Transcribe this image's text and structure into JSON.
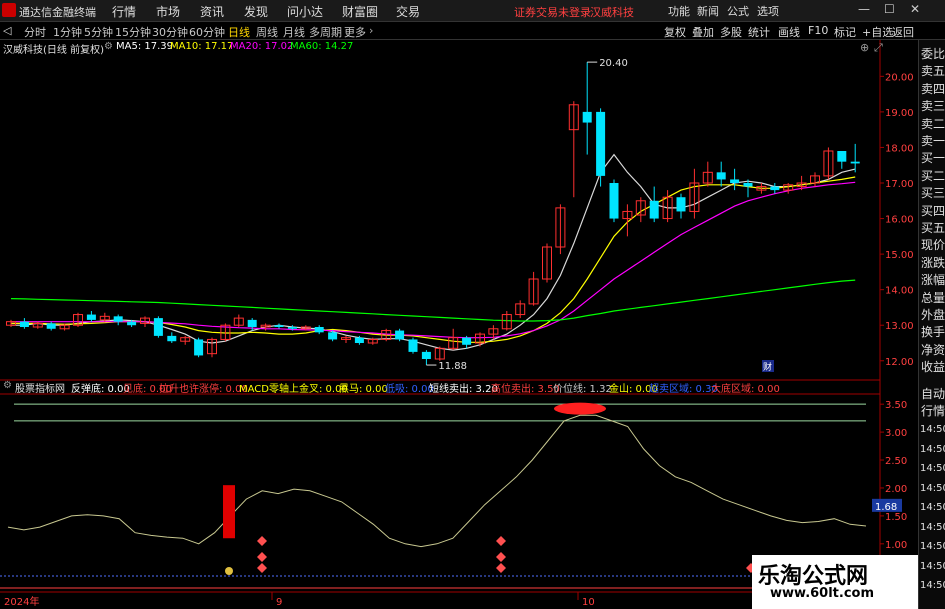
{
  "menubar": {
    "app_name": "通达信金融终端",
    "items": [
      "行情",
      "市场",
      "资讯",
      "发现",
      "问小达",
      "财富圈",
      "交易"
    ],
    "notice": "证券交易未登录",
    "stock_title": "汉威科技",
    "right_items": [
      "功能",
      "新闻",
      "公式",
      "选项"
    ],
    "win_controls": [
      "—",
      "☐",
      "✕"
    ]
  },
  "period_bar": {
    "items": [
      "分时",
      "1分钟",
      "5分钟",
      "15分钟",
      "30分钟",
      "60分钟",
      "日线",
      "周线",
      "月线",
      "多周期",
      "更多"
    ],
    "active": "日线",
    "right_tools": [
      "复权",
      "叠加",
      "多股",
      "统计",
      "画线",
      "F10",
      "标记",
      "+自选",
      "返回"
    ]
  },
  "info_line": {
    "stock": "汉威科技(日线 前复权)",
    "ma5": "MA5: 17.39",
    "ma10": "MA10: 17.17",
    "ma20": "MA20: 17.02",
    "ma60": "MA60: 14.27",
    "colors": {
      "ma5": "#ffffff",
      "ma10": "#ffff00",
      "ma20": "#ff00ff",
      "ma60": "#00ff00"
    }
  },
  "price_axis": [
    "20.00",
    "19.00",
    "18.00",
    "17.00",
    "16.00",
    "15.00",
    "14.00",
    "13.00",
    "12.00"
  ],
  "annotations": {
    "high": "20.40",
    "low": "11.88",
    "finance_marker": "财"
  },
  "indicator_line": {
    "name": "股票指标网",
    "items": [
      {
        "label": "反弹底: 0.00",
        "color": "#ffffff"
      },
      {
        "label": "见底: 0.00",
        "color": "#ff4040"
      },
      {
        "label": "拉升也许涨停: 0.00",
        "color": "#ff4040"
      },
      {
        "label": "MACD零轴上金叉: 0.00",
        "color": "#ffff00"
      },
      {
        "label": "黑马: 0.00",
        "color": "#ffff00"
      },
      {
        "label": "低吸: 0.00",
        "color": "#3060ff"
      },
      {
        "label": "短线卖出: 3.20",
        "color": "#ffffff"
      },
      {
        "label": "高位卖出: 3.50",
        "color": "#ff4040"
      },
      {
        "label": "价位线: 1.32",
        "color": "#c8c8c8"
      },
      {
        "label": "金山: 0.00",
        "color": "#ffff00"
      },
      {
        "label": "超卖区域: 0.30",
        "color": "#3060ff"
      },
      {
        "label": "大底区域: 0.00",
        "color": "#ff4040"
      }
    ]
  },
  "indicator_axis": [
    "3.50",
    "3.00",
    "2.50",
    "2.00",
    "1.50",
    "1.00"
  ],
  "indicator_current": "1.68",
  "time_axis": [
    "2024年",
    "9",
    "10"
  ],
  "side_tabs_top": [
    "委比",
    "卖五",
    "卖四",
    "卖三",
    "卖二",
    "卖一",
    "买一",
    "买二",
    "买三",
    "买四",
    "买五",
    "现价",
    "涨跌",
    "涨幅",
    "总量",
    "外盘",
    "换手",
    "净资",
    "收益"
  ],
  "side_tabs_bottom": [
    "自动",
    "行情"
  ],
  "side_times": [
    "14:50",
    "14:50",
    "14:50",
    "14:50",
    "14:50",
    "14:50",
    "14:50",
    "14:50",
    "14:50"
  ],
  "watermark": {
    "line1": "乐淘公式网",
    "line2": "www.60lt.com"
  },
  "chart_data": {
    "type": "candlestick",
    "price_range": [
      11.6,
      20.6
    ],
    "candles": [
      {
        "o": 13.0,
        "c": 13.1,
        "h": 13.15,
        "l": 12.95
      },
      {
        "o": 13.1,
        "c": 12.95,
        "h": 13.2,
        "l": 12.9
      },
      {
        "o": 12.95,
        "c": 13.05,
        "h": 13.1,
        "l": 12.9
      },
      {
        "o": 13.05,
        "c": 12.9,
        "h": 13.1,
        "l": 12.85
      },
      {
        "o": 12.9,
        "c": 13.0,
        "h": 13.05,
        "l": 12.85
      },
      {
        "o": 13.0,
        "c": 13.3,
        "h": 13.35,
        "l": 12.95
      },
      {
        "o": 13.3,
        "c": 13.15,
        "h": 13.4,
        "l": 13.1
      },
      {
        "o": 13.15,
        "c": 13.25,
        "h": 13.35,
        "l": 13.1
      },
      {
        "o": 13.25,
        "c": 13.1,
        "h": 13.3,
        "l": 13.0
      },
      {
        "o": 13.1,
        "c": 13.0,
        "h": 13.15,
        "l": 12.95
      },
      {
        "o": 13.05,
        "c": 13.2,
        "h": 13.25,
        "l": 12.95
      },
      {
        "o": 13.2,
        "c": 12.7,
        "h": 13.25,
        "l": 12.65
      },
      {
        "o": 12.7,
        "c": 12.55,
        "h": 12.8,
        "l": 12.5
      },
      {
        "o": 12.55,
        "c": 12.65,
        "h": 12.7,
        "l": 12.45
      },
      {
        "o": 12.6,
        "c": 12.15,
        "h": 12.65,
        "l": 12.1
      },
      {
        "o": 12.2,
        "c": 12.6,
        "h": 12.65,
        "l": 12.1
      },
      {
        "o": 12.6,
        "c": 13.0,
        "h": 13.05,
        "l": 12.55
      },
      {
        "o": 13.0,
        "c": 13.2,
        "h": 13.3,
        "l": 12.95
      },
      {
        "o": 13.15,
        "c": 12.95,
        "h": 13.2,
        "l": 12.85
      },
      {
        "o": 12.95,
        "c": 13.0,
        "h": 13.05,
        "l": 12.85
      },
      {
        "o": 13.0,
        "c": 12.95,
        "h": 13.05,
        "l": 12.9
      },
      {
        "o": 12.95,
        "c": 12.9,
        "h": 13.0,
        "l": 12.85
      },
      {
        "o": 12.9,
        "c": 12.95,
        "h": 13.0,
        "l": 12.85
      },
      {
        "o": 12.95,
        "c": 12.8,
        "h": 13.0,
        "l": 12.75
      },
      {
        "o": 12.8,
        "c": 12.6,
        "h": 12.85,
        "l": 12.55
      },
      {
        "o": 12.6,
        "c": 12.65,
        "h": 12.7,
        "l": 12.5
      },
      {
        "o": 12.65,
        "c": 12.5,
        "h": 12.7,
        "l": 12.45
      },
      {
        "o": 12.5,
        "c": 12.6,
        "h": 12.65,
        "l": 12.45
      },
      {
        "o": 12.6,
        "c": 12.85,
        "h": 12.9,
        "l": 12.55
      },
      {
        "o": 12.85,
        "c": 12.6,
        "h": 12.9,
        "l": 12.55
      },
      {
        "o": 12.6,
        "c": 12.25,
        "h": 12.65,
        "l": 12.2
      },
      {
        "o": 12.25,
        "c": 12.05,
        "h": 12.3,
        "l": 11.88
      },
      {
        "o": 12.05,
        "c": 12.35,
        "h": 12.4,
        "l": 12.0
      },
      {
        "o": 12.35,
        "c": 12.65,
        "h": 12.9,
        "l": 12.3
      },
      {
        "o": 12.65,
        "c": 12.45,
        "h": 12.7,
        "l": 12.35
      },
      {
        "o": 12.5,
        "c": 12.75,
        "h": 12.8,
        "l": 12.4
      },
      {
        "o": 12.75,
        "c": 12.9,
        "h": 13.0,
        "l": 12.6
      },
      {
        "o": 12.9,
        "c": 13.3,
        "h": 13.4,
        "l": 12.85
      },
      {
        "o": 13.3,
        "c": 13.6,
        "h": 13.7,
        "l": 13.2
      },
      {
        "o": 13.6,
        "c": 14.3,
        "h": 14.5,
        "l": 13.55
      },
      {
        "o": 14.3,
        "c": 15.2,
        "h": 15.3,
        "l": 14.2
      },
      {
        "o": 15.2,
        "c": 16.3,
        "h": 16.4,
        "l": 15.0
      },
      {
        "o": 18.5,
        "c": 19.2,
        "h": 19.3,
        "l": 16.6
      },
      {
        "o": 19.0,
        "c": 18.7,
        "h": 20.4,
        "l": 17.8
      },
      {
        "o": 19.0,
        "c": 17.2,
        "h": 19.1,
        "l": 16.9
      },
      {
        "o": 17.0,
        "c": 16.0,
        "h": 17.1,
        "l": 15.9
      },
      {
        "o": 16.0,
        "c": 16.2,
        "h": 16.4,
        "l": 15.5
      },
      {
        "o": 16.1,
        "c": 16.5,
        "h": 16.6,
        "l": 15.9
      },
      {
        "o": 16.5,
        "c": 16.0,
        "h": 16.9,
        "l": 15.9
      },
      {
        "o": 16.0,
        "c": 16.6,
        "h": 16.8,
        "l": 15.9
      },
      {
        "o": 16.6,
        "c": 16.2,
        "h": 16.7,
        "l": 16.0
      },
      {
        "o": 16.2,
        "c": 17.0,
        "h": 17.4,
        "l": 16.0
      },
      {
        "o": 17.0,
        "c": 17.3,
        "h": 17.6,
        "l": 16.9
      },
      {
        "o": 17.3,
        "c": 17.1,
        "h": 17.6,
        "l": 16.9
      },
      {
        "o": 17.1,
        "c": 17.0,
        "h": 17.4,
        "l": 16.8
      },
      {
        "o": 17.0,
        "c": 16.9,
        "h": 17.1,
        "l": 16.6
      },
      {
        "o": 16.8,
        "c": 16.9,
        "h": 17.0,
        "l": 16.7
      },
      {
        "o": 16.9,
        "c": 16.8,
        "h": 17.0,
        "l": 16.7
      },
      {
        "o": 16.8,
        "c": 16.95,
        "h": 17.0,
        "l": 16.7
      },
      {
        "o": 16.9,
        "c": 17.0,
        "h": 17.2,
        "l": 16.8
      },
      {
        "o": 17.0,
        "c": 17.2,
        "h": 17.3,
        "l": 16.9
      },
      {
        "o": 17.2,
        "c": 17.9,
        "h": 18.0,
        "l": 17.1
      },
      {
        "o": 17.9,
        "c": 17.6,
        "h": 17.9,
        "l": 17.4
      },
      {
        "o": 17.6,
        "c": 17.55,
        "h": 18.1,
        "l": 17.3
      }
    ],
    "ma": [
      {
        "name": "MA5",
        "color": "#ffffff",
        "values": [
          13.0,
          13.0,
          13.05,
          13.0,
          13.0,
          13.05,
          13.1,
          13.12,
          13.15,
          13.13,
          13.1,
          13.0,
          12.88,
          12.75,
          12.55,
          12.5,
          12.55,
          12.7,
          12.85,
          12.95,
          13.0,
          12.95,
          12.92,
          12.9,
          12.82,
          12.72,
          12.65,
          12.6,
          12.62,
          12.62,
          12.55,
          12.45,
          12.35,
          12.3,
          12.35,
          12.45,
          12.6,
          12.75,
          13.0,
          13.3,
          13.75,
          14.4,
          15.3,
          16.3,
          17.3,
          17.8,
          17.3,
          16.9,
          16.4,
          16.3,
          16.3,
          16.4,
          16.6,
          16.8,
          17.0,
          17.05,
          17.0,
          16.9,
          16.9,
          16.95,
          17.0,
          17.1,
          17.3,
          17.39
        ]
      },
      {
        "name": "MA10",
        "color": "#ffff00",
        "values": [
          13.05,
          13.05,
          13.05,
          13.04,
          13.03,
          13.04,
          13.05,
          13.07,
          13.1,
          13.1,
          13.1,
          13.08,
          13.02,
          12.95,
          12.85,
          12.8,
          12.78,
          12.78,
          12.8,
          12.78,
          12.75,
          12.75,
          12.78,
          12.85,
          12.88,
          12.85,
          12.8,
          12.75,
          12.72,
          12.72,
          12.7,
          12.65,
          12.6,
          12.55,
          12.52,
          12.52,
          12.55,
          12.6,
          12.7,
          12.85,
          13.05,
          13.35,
          13.75,
          14.3,
          14.9,
          15.5,
          15.9,
          16.2,
          16.4,
          16.6,
          16.8,
          16.9,
          16.95,
          16.95,
          16.95,
          16.9,
          16.85,
          16.85,
          16.9,
          16.95,
          17.0,
          17.05,
          17.1,
          17.17
        ]
      },
      {
        "name": "MA20",
        "color": "#ff00ff",
        "values": [
          13.1,
          13.1,
          13.1,
          13.1,
          13.1,
          13.1,
          13.1,
          13.1,
          13.1,
          13.1,
          13.1,
          13.08,
          13.06,
          13.04,
          13.0,
          12.97,
          12.95,
          12.93,
          12.92,
          12.9,
          12.9,
          12.88,
          12.87,
          12.86,
          12.85,
          12.82,
          12.8,
          12.78,
          12.75,
          12.73,
          12.72,
          12.7,
          12.68,
          12.66,
          12.65,
          12.65,
          12.66,
          12.7,
          12.76,
          12.85,
          12.98,
          13.15,
          13.4,
          13.7,
          14.0,
          14.3,
          14.55,
          14.8,
          15.05,
          15.3,
          15.55,
          15.75,
          15.95,
          16.15,
          16.35,
          16.5,
          16.6,
          16.7,
          16.78,
          16.85,
          16.9,
          16.95,
          16.98,
          17.02
        ]
      },
      {
        "name": "MA60",
        "color": "#00ff00",
        "values": [
          13.75,
          13.74,
          13.73,
          13.72,
          13.71,
          13.7,
          13.69,
          13.68,
          13.67,
          13.66,
          13.65,
          13.64,
          13.62,
          13.6,
          13.58,
          13.56,
          13.54,
          13.52,
          13.5,
          13.48,
          13.46,
          13.44,
          13.42,
          13.4,
          13.38,
          13.36,
          13.34,
          13.32,
          13.3,
          13.28,
          13.26,
          13.24,
          13.22,
          13.2,
          13.18,
          13.16,
          13.14,
          13.13,
          13.12,
          13.12,
          13.13,
          13.15,
          13.2,
          13.27,
          13.33,
          13.4,
          13.45,
          13.5,
          13.55,
          13.6,
          13.65,
          13.7,
          13.75,
          13.8,
          13.85,
          13.9,
          13.95,
          14.0,
          14.05,
          14.1,
          14.15,
          14.2,
          14.24,
          14.27
        ]
      }
    ],
    "indicator": {
      "range": [
        0.8,
        3.7
      ],
      "hline_values": [
        3.5,
        3.2
      ],
      "line": [
        1.3,
        1.25,
        1.3,
        1.4,
        1.5,
        1.52,
        1.5,
        1.45,
        1.2,
        1.15,
        1.12,
        1.1,
        1.0,
        1.2,
        1.5,
        1.8,
        1.95,
        1.9,
        1.98,
        1.95,
        1.85,
        1.75,
        1.55,
        1.35,
        1.1,
        1.0,
        0.95,
        1.0,
        1.1,
        1.4,
        1.7,
        1.95,
        2.2,
        2.5,
        2.85,
        3.2,
        3.3,
        3.3,
        3.2,
        3.1,
        2.7,
        2.4,
        2.2,
        2.1,
        1.95,
        1.8,
        1.7,
        1.6,
        1.5,
        1.42,
        1.38,
        1.4,
        1.45,
        1.35,
        1.32
      ]
    }
  }
}
